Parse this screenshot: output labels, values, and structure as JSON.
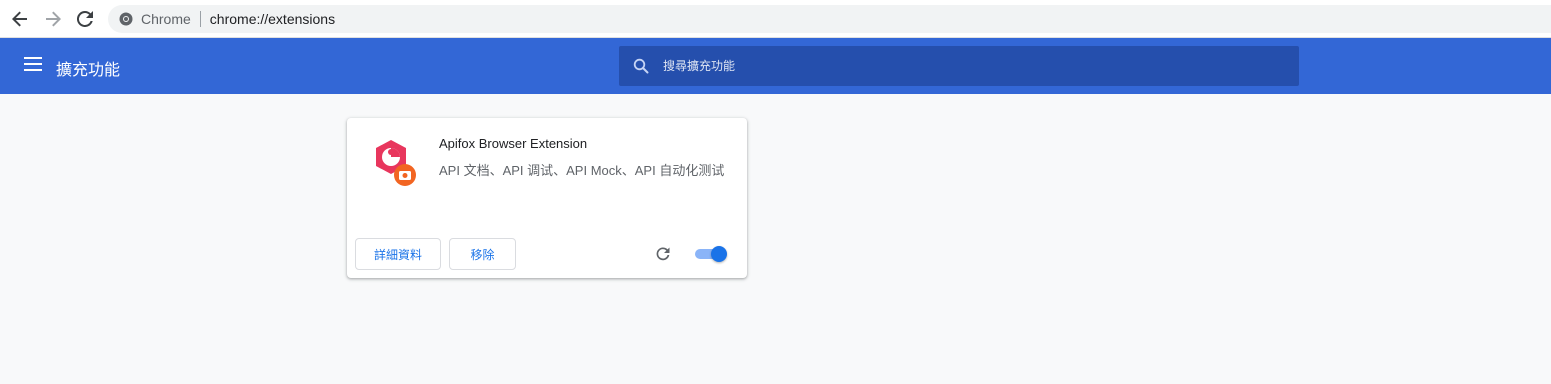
{
  "browser": {
    "omnibox_chip": "Chrome",
    "omnibox_url": "chrome://extensions"
  },
  "header": {
    "title": "擴充功能",
    "search_placeholder": "搜尋擴充功能"
  },
  "extension": {
    "name": "Apifox Browser Extension",
    "description": "API 文档、API 调试、API Mock、API 自动化测试",
    "details_label": "詳細資料",
    "remove_label": "移除",
    "enabled": true
  },
  "colors": {
    "header_bg": "#3367d6",
    "search_bg": "#254fad",
    "accent": "#1a73e8",
    "icon_primary": "#e8365d",
    "icon_badge": "#f26522"
  }
}
